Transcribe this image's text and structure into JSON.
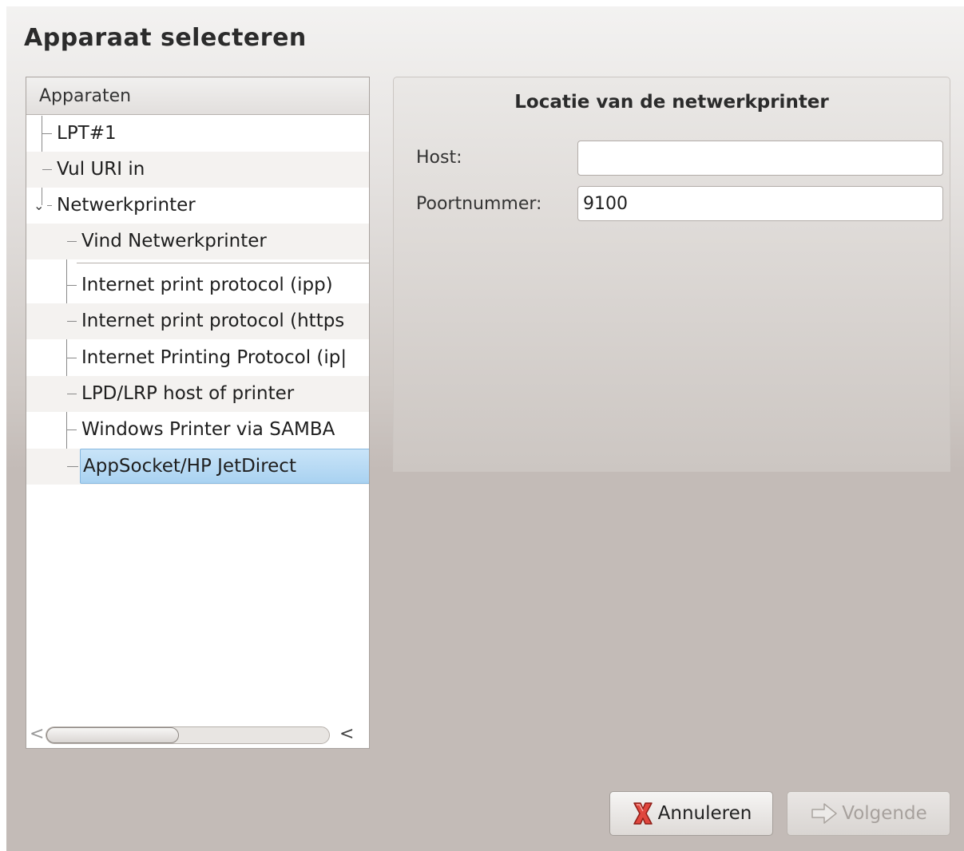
{
  "dialog": {
    "title": "Apparaat selecteren"
  },
  "tree": {
    "header": "Apparaten",
    "items": [
      {
        "label": "LPT#1",
        "level": 1
      },
      {
        "label": "Vul URI in",
        "level": 1
      },
      {
        "label": "Netwerkprinter",
        "level": 1,
        "expanded": true
      },
      {
        "label": "Vind Netwerkprinter",
        "level": 2
      },
      {
        "label": "Internet print protocol (ipp)",
        "level": 2
      },
      {
        "label": "Internet print protocol (https",
        "level": 2
      },
      {
        "label": "Internet Printing Protocol (ip|",
        "level": 2
      },
      {
        "label": "LPD/LRP host of printer",
        "level": 2
      },
      {
        "label": "Windows Printer via SAMBA",
        "level": 2
      },
      {
        "label": "AppSocket/HP JetDirect",
        "level": 2,
        "selected": true
      }
    ],
    "expander_glyph": "⌄",
    "scroll_left_glyph": "<",
    "scroll_right_glyphs": "< >"
  },
  "location": {
    "title": "Locatie van de netwerkprinter",
    "host_label": "Host:",
    "host_value": "",
    "port_label": "Poortnummer:",
    "port_value": "9100"
  },
  "buttons": {
    "cancel_label": "Annuleren",
    "cancel_icon": "red-x-icon",
    "next_label": "Volgende",
    "next_icon": "right-arrow-icon",
    "next_enabled": false
  },
  "colors": {
    "selection": "#a9d2f1",
    "cancel_icon": "#d9322b"
  }
}
